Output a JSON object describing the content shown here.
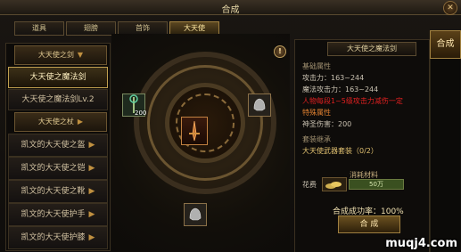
{
  "window": {
    "title": "合成",
    "close_glyph": "✕"
  },
  "tabs": [
    {
      "label": "道具",
      "active": false
    },
    {
      "label": "翅膀",
      "active": false
    },
    {
      "label": "首饰",
      "active": false
    },
    {
      "label": "大天使",
      "active": true
    }
  ],
  "left_list": {
    "category_1": {
      "label": "大天使之剑",
      "arrow": "▼"
    },
    "items_1": [
      {
        "label": "大天使之魔法剑",
        "selected": true
      },
      {
        "label": "大天使之魔法剑Lv.2",
        "selected": false
      }
    ],
    "category_2": {
      "label": "大天使之杖",
      "arrow": "▶"
    },
    "items_2": [
      {
        "label": "凯文的大天使之盔",
        "arrow": "▶"
      },
      {
        "label": "凯文的大天使之铠",
        "arrow": "▶"
      },
      {
        "label": "凯文的大天使之靴",
        "arrow": "▶"
      },
      {
        "label": "凯文的大天使护手",
        "arrow": "▶"
      },
      {
        "label": "凯文的大天使护膝",
        "arrow": "▶"
      }
    ]
  },
  "center": {
    "material_count": "200",
    "info_glyph": "!"
  },
  "detail": {
    "title": "大天使之魔法剑",
    "base_header": "基础属性",
    "attack": "攻击力：163~244",
    "magic_attack": "魔法攻击力：163~244",
    "special_red": "人物每段1~5级攻击力减伤一定",
    "special_header": "特殊属性",
    "holy_damage": "神圣伤害：200",
    "set_header": "套装继承",
    "set_value": "大天使武器套装（0/2）",
    "materials_header": "消耗材料",
    "cost_label": "花费",
    "cost_value": "50万",
    "success_rate": "合成成功率：100%",
    "compose_button": "合 成"
  },
  "side_tab": {
    "label": "合成"
  },
  "watermark": "muqj4.com",
  "colors": {
    "accent": "#c0a050",
    "danger": "#e02020",
    "special": "#e08030"
  }
}
